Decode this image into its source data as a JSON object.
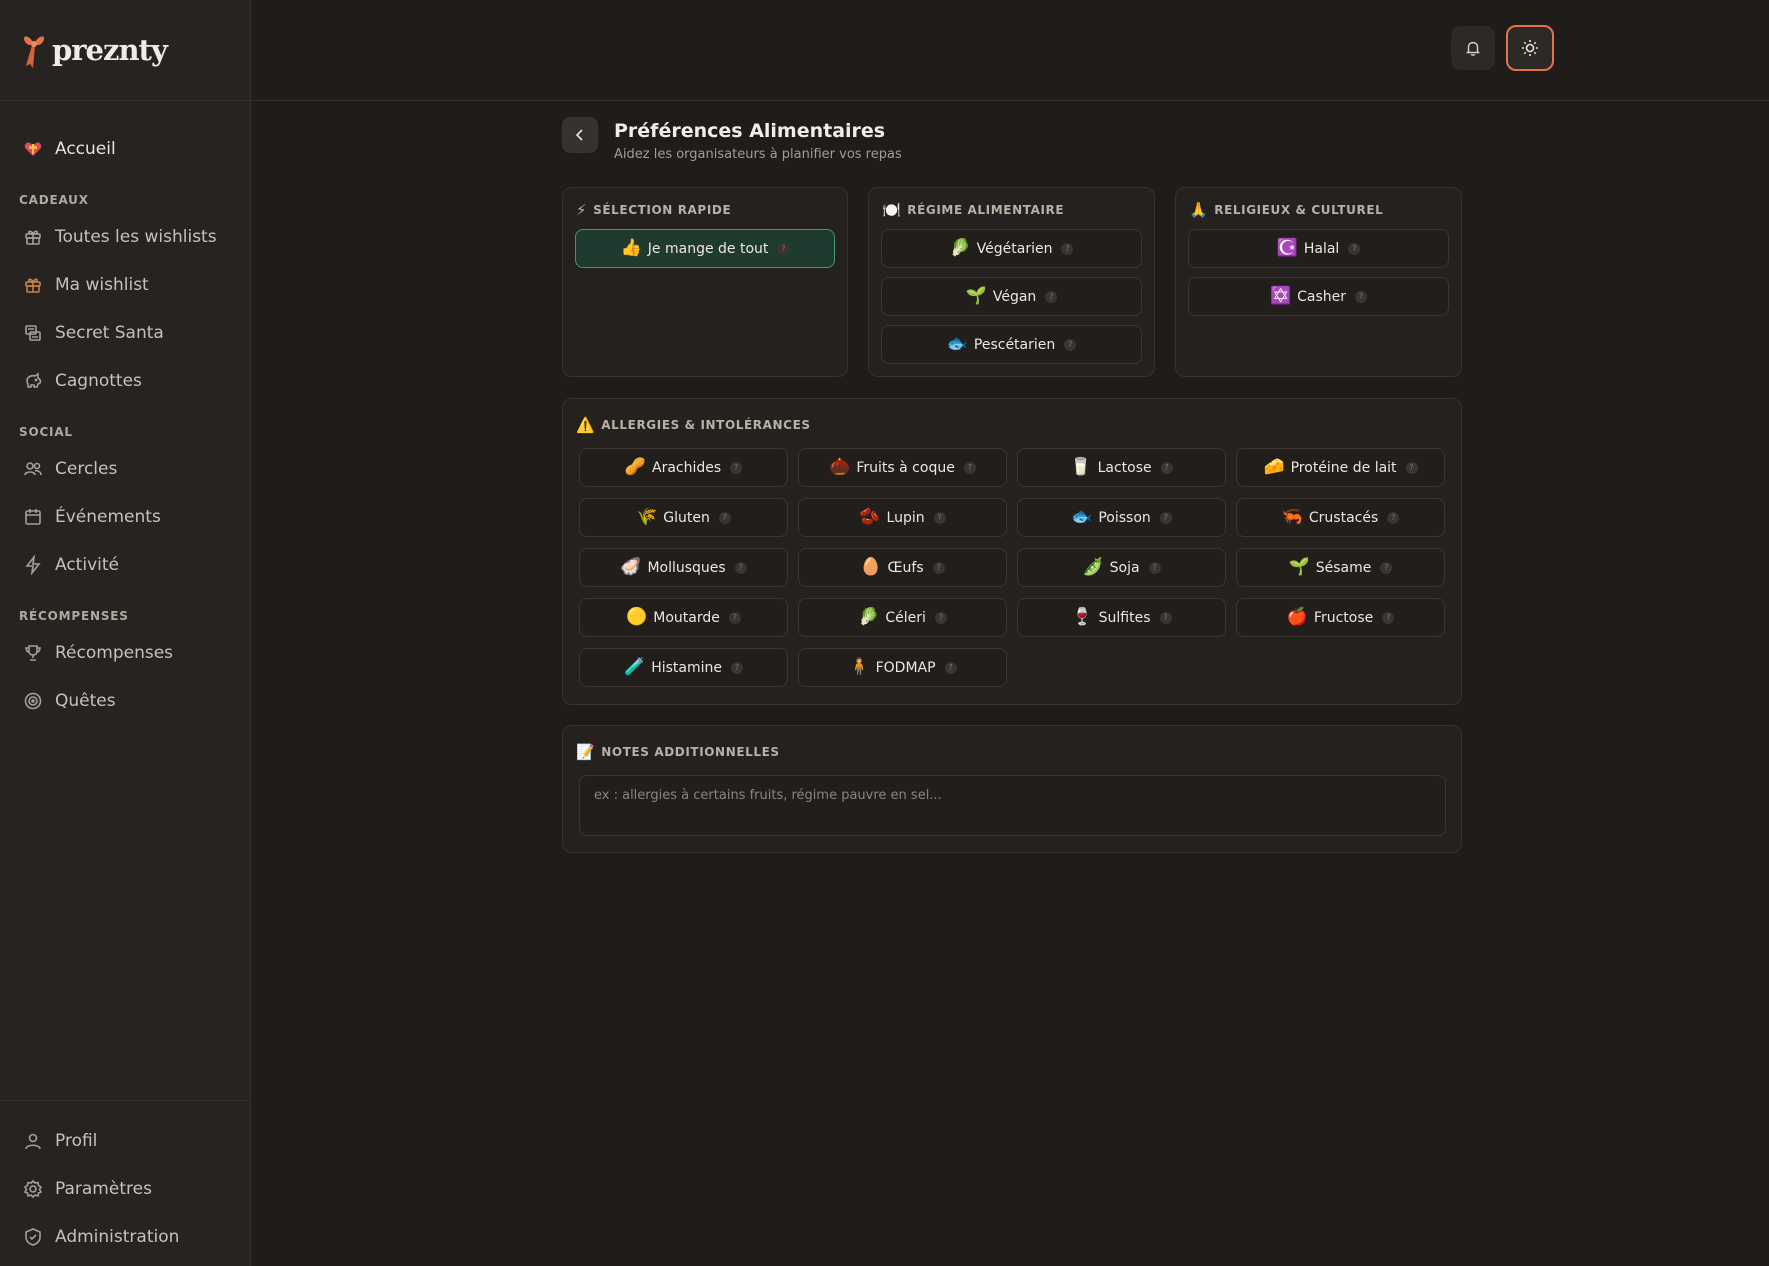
{
  "app": {
    "logo_text": "preznty"
  },
  "sidebar": {
    "home": {
      "label": "Accueil",
      "icon": "heart-gift-icon"
    },
    "sections": [
      {
        "title": "CADEAUX",
        "items": [
          {
            "label": "Toutes les wishlists",
            "icon": "gift-icon"
          },
          {
            "label": "Ma wishlist",
            "icon": "gift-icon"
          },
          {
            "label": "Secret Santa",
            "icon": "exchange-icon"
          },
          {
            "label": "Cagnottes",
            "icon": "piggy-bank-icon"
          }
        ]
      },
      {
        "title": "SOCIAL",
        "items": [
          {
            "label": "Cercles",
            "icon": "users-icon"
          },
          {
            "label": "Événements",
            "icon": "calendar-icon"
          },
          {
            "label": "Activité",
            "icon": "lightning-icon"
          }
        ]
      },
      {
        "title": "RÉCOMPENSES",
        "items": [
          {
            "label": "Récompenses",
            "icon": "trophy-icon"
          },
          {
            "label": "Quêtes",
            "icon": "target-icon"
          }
        ]
      }
    ],
    "bottom": [
      {
        "label": "Profil",
        "icon": "user-icon"
      },
      {
        "label": "Paramètres",
        "icon": "gear-icon"
      },
      {
        "label": "Administration",
        "icon": "shield-icon"
      }
    ]
  },
  "header": {
    "bell": "bell-icon",
    "theme": "sun-icon"
  },
  "page": {
    "title": "Préférences Alimentaires",
    "subtitle": "Aidez les organisateurs à planifier vos repas"
  },
  "quick": {
    "title": "SÉLECTION RAPIDE",
    "emoji": "⚡",
    "items": [
      {
        "label": "Je mange de tout",
        "emoji": "👍",
        "selected": true
      }
    ]
  },
  "diet": {
    "title": "RÉGIME ALIMENTAIRE",
    "emoji": "🍽️",
    "items": [
      {
        "label": "Végétarien",
        "emoji": "🥬"
      },
      {
        "label": "Végan",
        "emoji": "🌱"
      },
      {
        "label": "Pescétarien",
        "emoji": "🐟"
      }
    ]
  },
  "religion": {
    "title": "RELIGIEUX & CULTUREL",
    "emoji": "🙏",
    "items": [
      {
        "label": "Halal",
        "emoji": "☪️"
      },
      {
        "label": "Casher",
        "emoji": "✡️"
      }
    ]
  },
  "allergies": {
    "title": "ALLERGIES & INTOLÉRANCES",
    "emoji": "⚠️",
    "items": [
      {
        "label": "Arachides",
        "emoji": "🥜"
      },
      {
        "label": "Fruits à coque",
        "emoji": "🌰"
      },
      {
        "label": "Lactose",
        "emoji": "🥛"
      },
      {
        "label": "Protéine de lait",
        "emoji": "🧀"
      },
      {
        "label": "Gluten",
        "emoji": "🌾"
      },
      {
        "label": "Lupin",
        "emoji": "🫘"
      },
      {
        "label": "Poisson",
        "emoji": "🐟"
      },
      {
        "label": "Crustacés",
        "emoji": "🦐"
      },
      {
        "label": "Mollusques",
        "emoji": "🦪"
      },
      {
        "label": "Œufs",
        "emoji": "🥚"
      },
      {
        "label": "Soja",
        "emoji": "🫛"
      },
      {
        "label": "Sésame",
        "emoji": "🌱"
      },
      {
        "label": "Moutarde",
        "emoji": "🟡"
      },
      {
        "label": "Céleri",
        "emoji": "🥬"
      },
      {
        "label": "Sulfites",
        "emoji": "🍷"
      },
      {
        "label": "Fructose",
        "emoji": "🍎"
      },
      {
        "label": "Histamine",
        "emoji": "🧪"
      },
      {
        "label": "FODMAP",
        "emoji": "🧍"
      }
    ]
  },
  "notes": {
    "title": "NOTES ADDITIONNELLES",
    "emoji": "📝",
    "placeholder": "ex : allergies à certains fruits, régime pauvre en sel..."
  },
  "help_glyph": "?"
}
